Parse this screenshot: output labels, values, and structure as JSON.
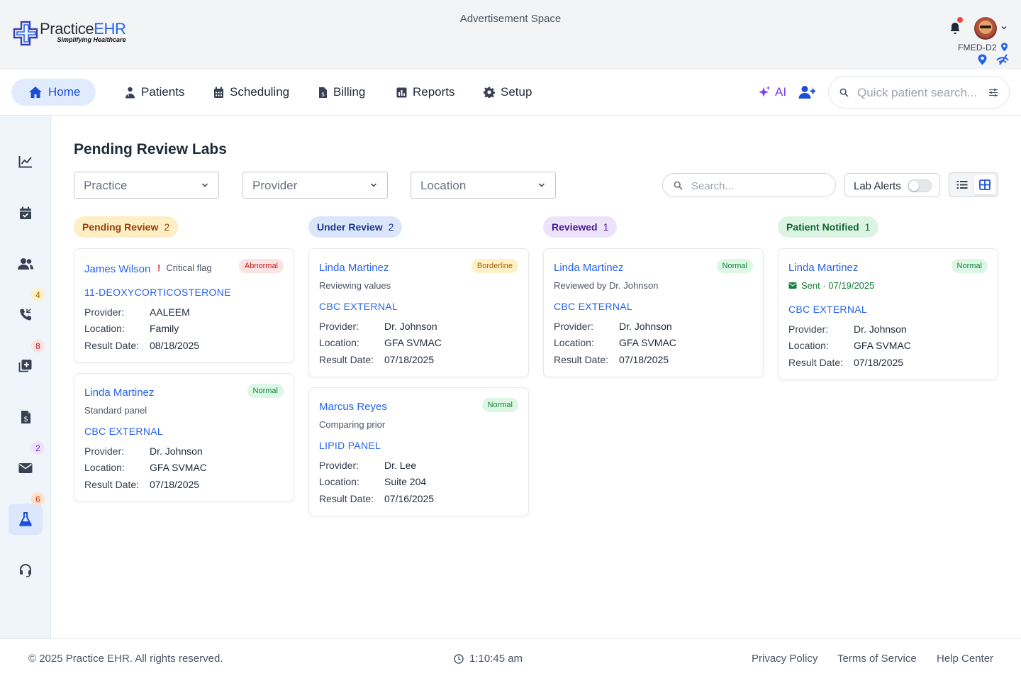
{
  "header": {
    "logo_main": "Practice",
    "logo_accent": "EHR",
    "logo_tagline": "Simplifying Healthcare",
    "ad_space": "Advertisement Space",
    "clinic_code": "FMED-D2"
  },
  "nav": {
    "items": [
      {
        "label": "Home",
        "icon": "home-icon"
      },
      {
        "label": "Patients",
        "icon": "patient-icon"
      },
      {
        "label": "Scheduling",
        "icon": "calendar-icon"
      },
      {
        "label": "Billing",
        "icon": "invoice-icon"
      },
      {
        "label": "Reports",
        "icon": "chart-icon"
      },
      {
        "label": "Setup",
        "icon": "gear-icon"
      }
    ],
    "ai_label": "AI",
    "quick_search_placeholder": "Quick patient search..."
  },
  "sidebar": {
    "items": [
      {
        "icon": "analytics-icon"
      },
      {
        "icon": "calendar-check-icon"
      },
      {
        "icon": "users-icon"
      },
      {
        "icon": "phone-icon",
        "badge": "4"
      },
      {
        "icon": "medical-plus-icon",
        "badge": "8"
      },
      {
        "icon": "billing-file-icon"
      },
      {
        "icon": "mail-icon",
        "badge": "2"
      },
      {
        "icon": "flask-icon",
        "badge": "6"
      },
      {
        "icon": "headset-icon"
      }
    ]
  },
  "page": {
    "title": "Pending Review Labs",
    "filters": {
      "practice": "Practice",
      "provider": "Provider",
      "location": "Location"
    },
    "search_placeholder": "Search...",
    "lab_alerts_label": "Lab Alerts"
  },
  "columns": [
    {
      "title": "Pending Review",
      "count": "2",
      "cards": [
        {
          "name": "James Wilson",
          "flag": "Critical flag",
          "status": "Abnormal",
          "test": "11-DEOXYCORTICOSTERONE",
          "provider": "AALEEM",
          "location": "Family",
          "result_date": "08/18/2025"
        },
        {
          "name": "Linda Martinez",
          "sub": "Standard panel",
          "status": "Normal",
          "test": "CBC EXTERNAL",
          "provider": "Dr. Johnson",
          "location": "GFA SVMAC",
          "result_date": "07/18/2025"
        }
      ]
    },
    {
      "title": "Under Review",
      "count": "2",
      "cards": [
        {
          "name": "Linda Martinez",
          "sub": "Reviewing values",
          "status": "Borderline",
          "test": "CBC EXTERNAL",
          "provider": "Dr. Johnson",
          "location": "GFA SVMAC",
          "result_date": "07/18/2025"
        },
        {
          "name": "Marcus Reyes",
          "sub": "Comparing prior",
          "status": "Normal",
          "test": "LIPID PANEL",
          "provider": "Dr. Lee",
          "location": "Suite 204",
          "result_date": "07/16/2025"
        }
      ]
    },
    {
      "title": "Reviewed",
      "count": "1",
      "cards": [
        {
          "name": "Linda Martinez",
          "sub": "Reviewed by Dr. Johnson",
          "status": "Normal",
          "test": "CBC EXTERNAL",
          "provider": "Dr. Johnson",
          "location": "GFA SVMAC",
          "result_date": "07/18/2025"
        }
      ]
    },
    {
      "title": "Patient Notified",
      "count": "1",
      "cards": [
        {
          "name": "Linda Martinez",
          "sub": "Sent · 07/19/2025",
          "status": "Normal",
          "test": "CBC EXTERNAL",
          "provider": "Dr. Johnson",
          "location": "GFA SVMAC",
          "result_date": "07/18/2025"
        }
      ]
    }
  ],
  "field_labels": {
    "provider": "Provider:",
    "location": "Location:",
    "result_date": "Result Date:"
  },
  "footer": {
    "copyright": "© 2025 Practice EHR. All rights reserved.",
    "time": "1:10:45 am",
    "links": [
      "Privacy Policy",
      "Terms of Service",
      "Help Center"
    ]
  },
  "colors": {
    "accent": "#2563eb",
    "pending_pill": "#fdefc3",
    "under_review_pill": "#dbe6fb",
    "reviewed_pill": "#ece3fb",
    "notified_pill": "#dbf5e2"
  }
}
